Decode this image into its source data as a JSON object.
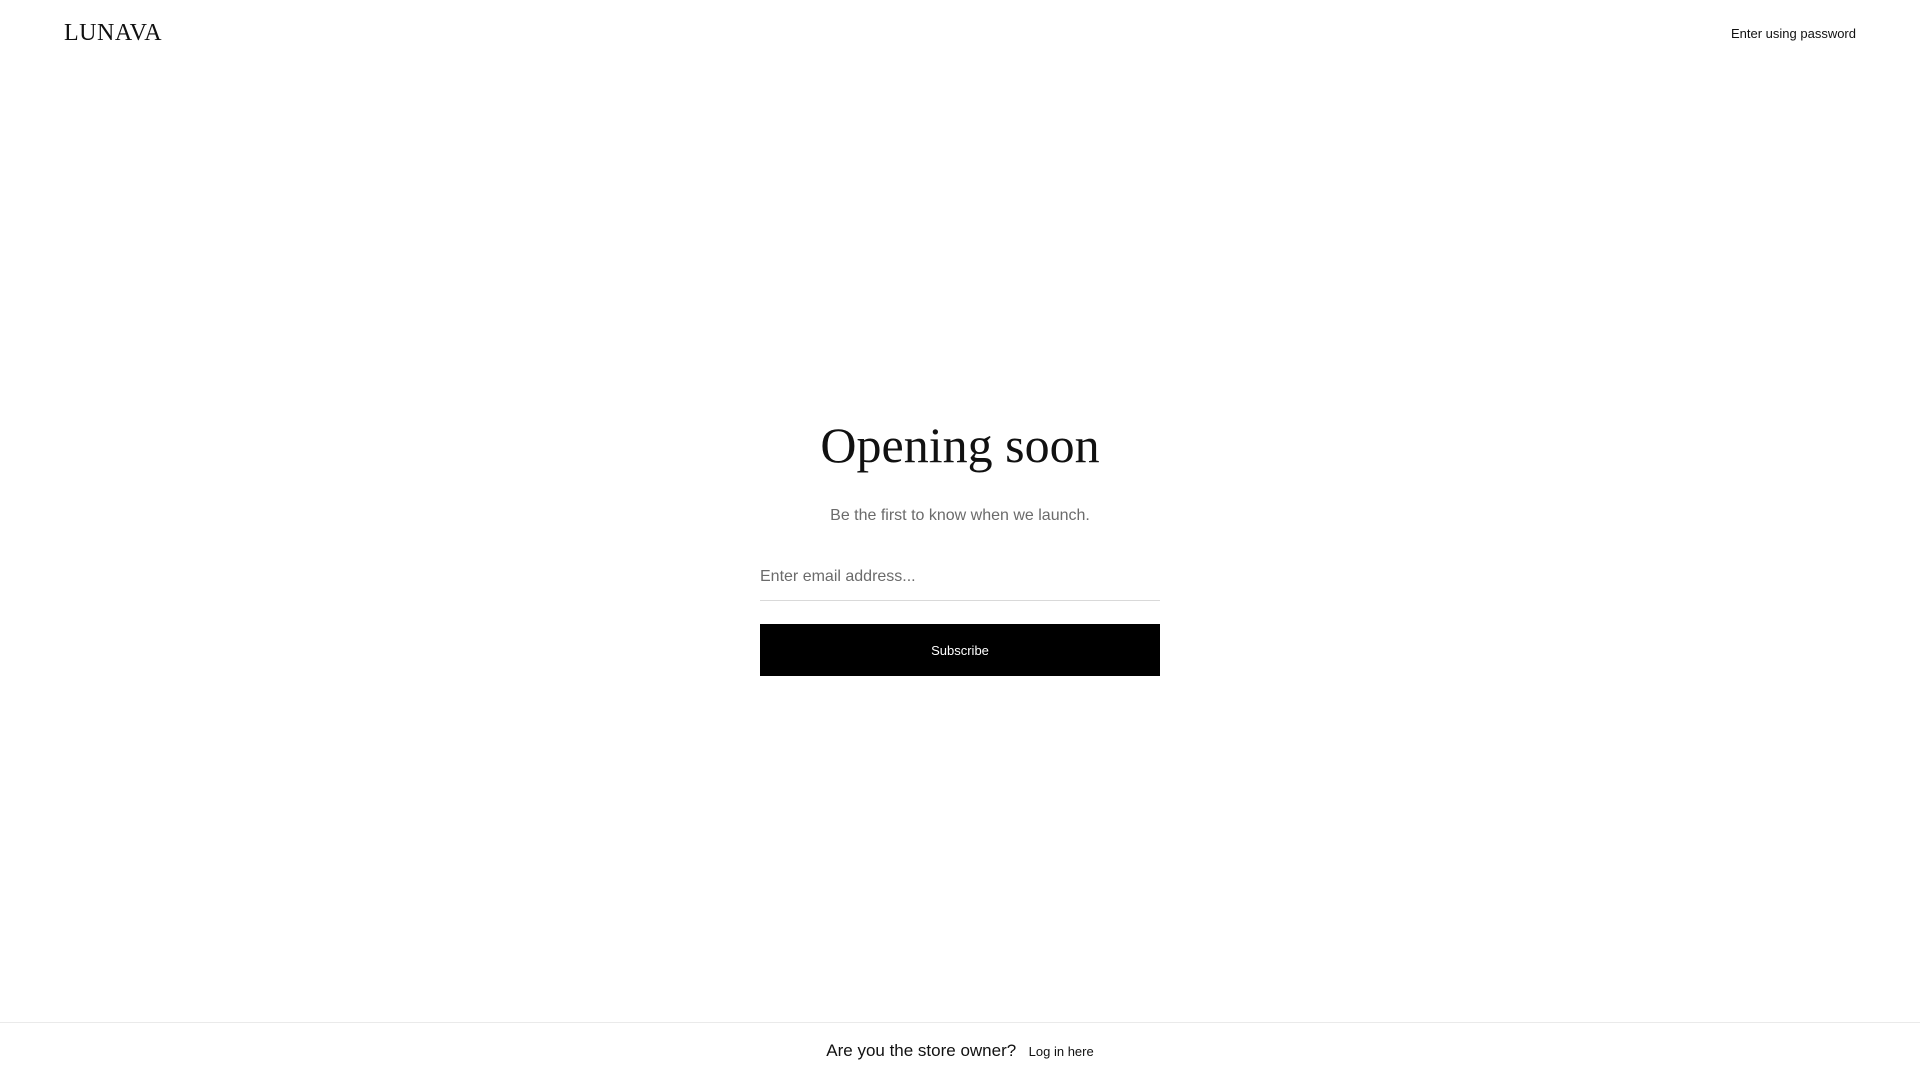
{
  "header": {
    "logo_text": "LUNAVA",
    "password_link_label": "Enter using password"
  },
  "hero": {
    "title": "Opening soon",
    "subtitle": "Be the first to know when we launch."
  },
  "signup": {
    "email_placeholder": "Enter email address...",
    "email_value": "",
    "subscribe_label": "Subscribe"
  },
  "footer": {
    "owner_question": "Are you the store owner?",
    "login_label": "Log in here"
  },
  "colors": {
    "background": "#ffffff",
    "text": "#111111",
    "muted_text": "#6b6b6b",
    "button_background": "#000000",
    "button_text": "#ffffff",
    "divider": "#eaeaea"
  }
}
